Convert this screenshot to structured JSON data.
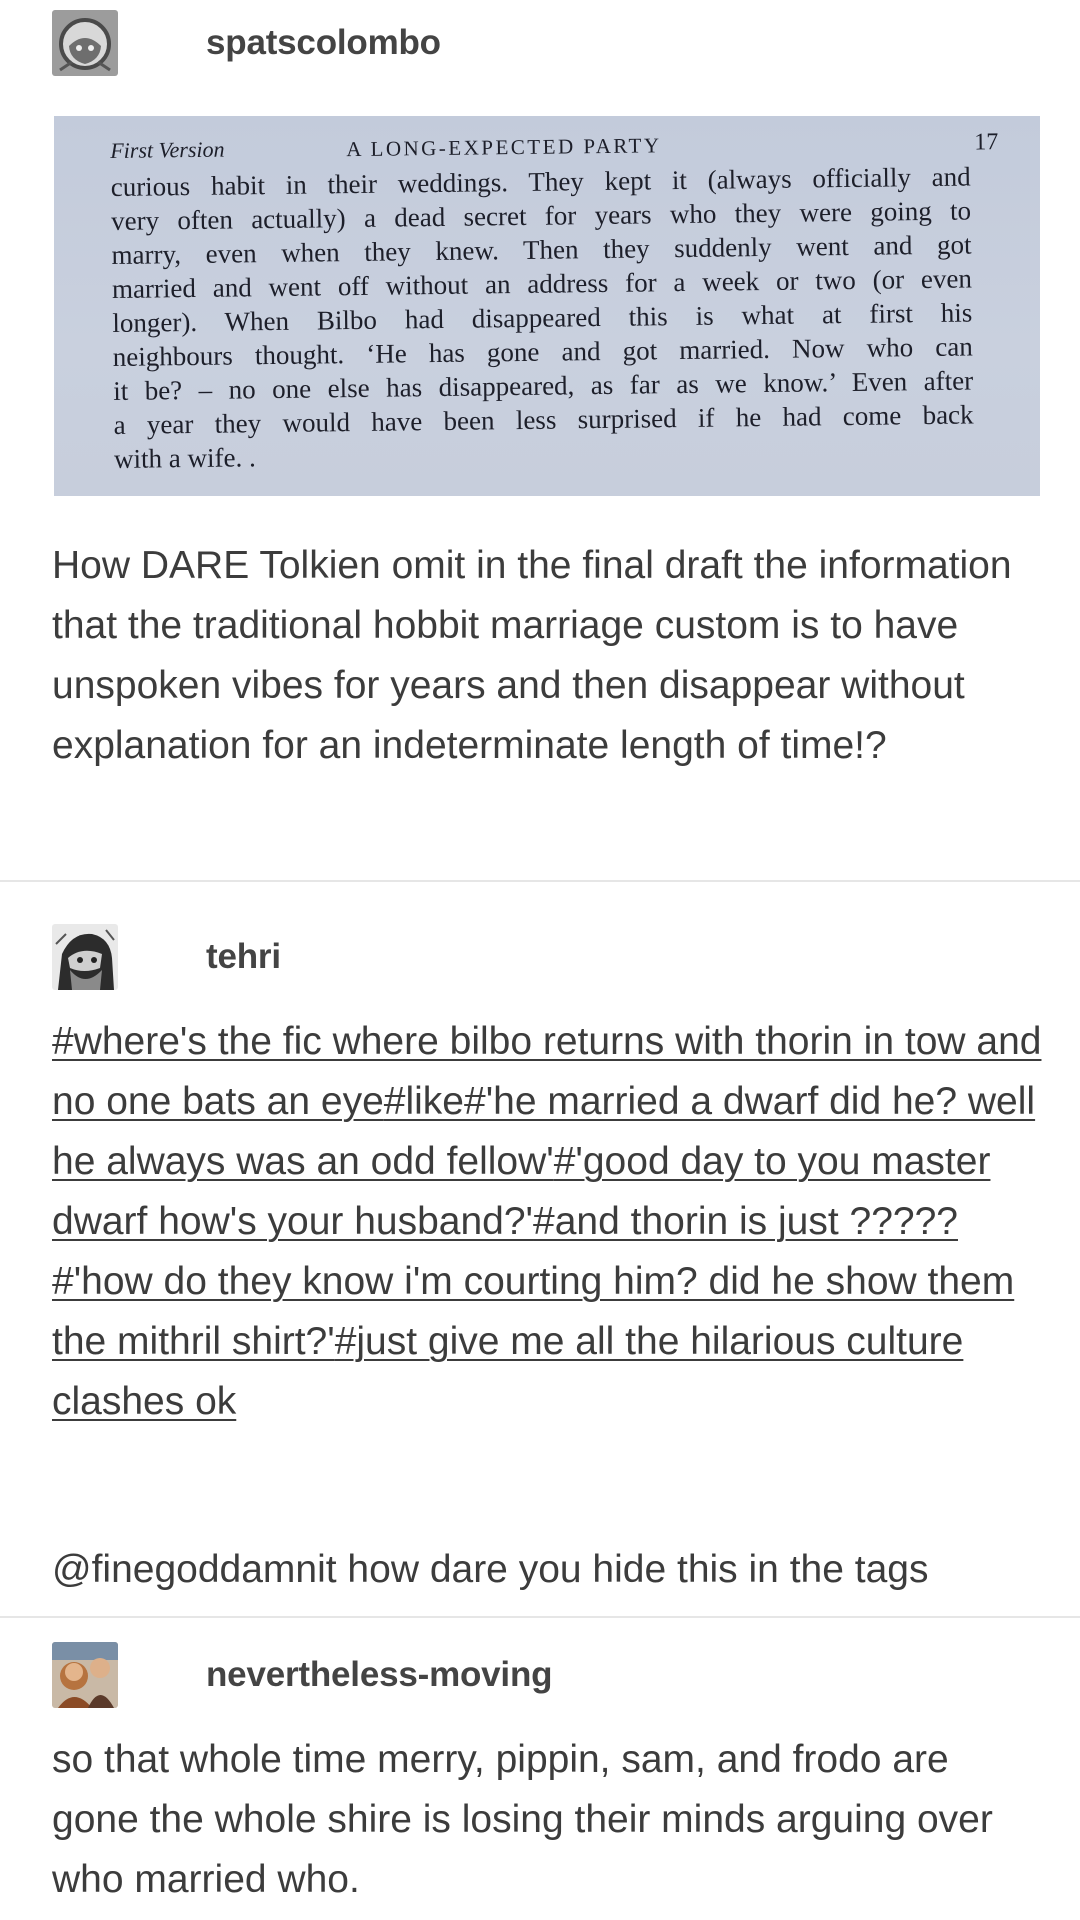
{
  "posts": [
    {
      "username": "spatscolombo",
      "avatar_icon": "astronaut-helmet-avatar-icon",
      "book_scan": {
        "header_left": "First Version",
        "header_center": "A LONG-EXPECTED PARTY",
        "header_right": "17",
        "lines": [
          "curious habit in their weddings. They kept it (always officially and",
          "very often actually) a dead secret for years who they were going to",
          "marry, even when they knew. Then they suddenly went and got",
          "married and went off without an address for a week or two (or even",
          "longer). When Bilbo had disappeared this is what at first his",
          "neighbours thought. ‘He has gone and got married. Now who can",
          "it be? – no one else has disappeared, as far as we know.’ Even after",
          "a year they would have been less surprised if he had come back",
          "with a wife. ."
        ]
      },
      "text": "How DARE Tolkien omit in the final draft the information that the traditional hobbit marriage custom is to have unspoken vibes for years and then disappear without explanation for an indeterminate length of time!?"
    },
    {
      "username": "tehri",
      "avatar_icon": "dwarf-drawing-avatar-icon",
      "tags": [
        "#where's the fic where bilbo returns with thorin in tow and no one bats an eye",
        "#like",
        "#'he married a dwarf did he? well he always was an odd fellow'",
        "#'good day to you master dwarf how's your husband?'",
        "#and thorin is just ?????",
        "#'how do they know i'm courting him? did he show them the mithril shirt?'",
        "#just give me all the hilarious culture clashes ok"
      ],
      "text": "@finegoddamnit how dare you hide this in the tags"
    },
    {
      "username": "nevertheless-moving",
      "avatar_icon": "hobbit-photo-avatar-icon",
      "text": "so that whole time merry, pippin, sam, and frodo are gone the whole shire is losing their minds arguing over who married who."
    }
  ],
  "colors": {
    "text": "#3c3c3c",
    "username": "#444444",
    "divider": "#e6e6e6",
    "scan_background": "#c7cedc"
  }
}
